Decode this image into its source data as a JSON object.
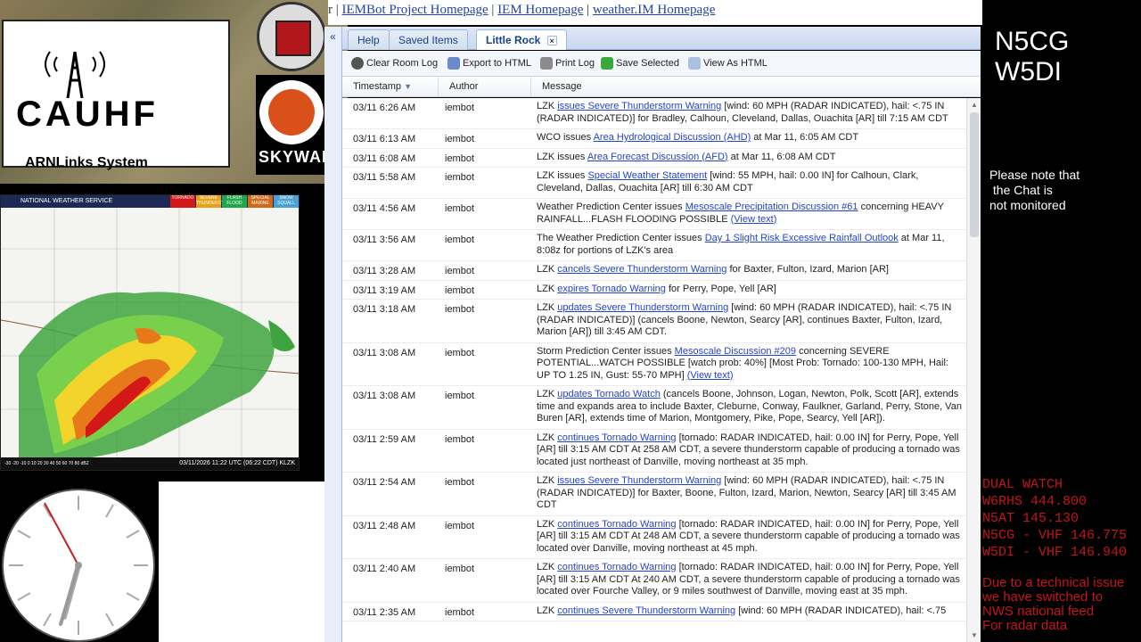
{
  "branding": {
    "logo_text": "CAUHF",
    "logo_subtitle": "ARNLinks System",
    "skywarn_text": "SKYWARN"
  },
  "radar": {
    "header": "NATIONAL WEATHER SERVICE",
    "legend": [
      "TORNADO",
      "SEVERE THUNDERSTORM",
      "FLASH FLOOD",
      "SPECIAL MARINE",
      "SNOW SQUALL"
    ],
    "timestamp": "03/11/2026 11:22 UTC (06:22 CDT)",
    "station": "KLZK",
    "scale": "-30 -20 -10 0 10 20 30 40 50 60 70 80 dBZ"
  },
  "topbar": {
    "prefix": "r",
    "links": [
      "IEMBot Project Homepage",
      "IEM Homepage",
      "weather.IM Homepage"
    ]
  },
  "tabs": [
    {
      "label": "Help",
      "active": false
    },
    {
      "label": "Saved Items",
      "active": false
    },
    {
      "label": "Little Rock",
      "active": true,
      "close": "×"
    }
  ],
  "collapse_label": "«",
  "toolbar": {
    "clear": "Clear Room Log",
    "export": "Export to HTML",
    "print": "Print Log",
    "save": "Save Selected",
    "view": "View As HTML"
  },
  "columns": {
    "timestamp": "Timestamp",
    "author": "Author",
    "message": "Message"
  },
  "rows": [
    {
      "ts": "03/11 6:26 AM",
      "author": "iembot",
      "pre": "LZK ",
      "link": "issues Severe Thunderstorm Warning",
      "post": " [wind: 60 MPH (RADAR INDICATED), hail: <.75 IN (RADAR INDICATED)] for Bradley, Calhoun, Cleveland, Dallas, Ouachita [AR] till 7:15 AM CDT"
    },
    {
      "ts": "03/11 6:13 AM",
      "author": "iembot",
      "pre": "WCO issues ",
      "link": "Area Hydrological Discussion (AHD)",
      "post": " at Mar 11, 6:05 AM CDT"
    },
    {
      "ts": "03/11 6:08 AM",
      "author": "iembot",
      "pre": "LZK issues ",
      "link": "Area Forecast Discussion (AFD)",
      "post": " at Mar 11, 6:08 AM CDT"
    },
    {
      "ts": "03/11 5:58 AM",
      "author": "iembot",
      "pre": "LZK issues ",
      "link": "Special Weather Statement",
      "post": " [wind: 55 MPH, hail: 0.00 IN] for Calhoun, Clark, Cleveland, Dallas, Ouachita [AR] till 6:30 AM CDT"
    },
    {
      "ts": "03/11 4:56 AM",
      "author": "iembot",
      "pre": "Weather Prediction Center issues ",
      "link": "Mesoscale Precipitation Discussion #61",
      "post": " concerning HEAVY RAINFALL...FLASH FLOODING POSSIBLE ",
      "link2": "(View text)"
    },
    {
      "ts": "03/11 3:56 AM",
      "author": "iembot",
      "pre": "The Weather Prediction Center issues ",
      "link": "Day 1 Slight Risk Excessive Rainfall Outlook",
      "post": " at Mar 11, 8:08z for portions of LZK's area"
    },
    {
      "ts": "03/11 3:28 AM",
      "author": "iembot",
      "pre": "LZK ",
      "link": "cancels Severe Thunderstorm Warning",
      "post": " for Baxter, Fulton, Izard, Marion [AR]"
    },
    {
      "ts": "03/11 3:19 AM",
      "author": "iembot",
      "pre": "LZK ",
      "link": "expires Tornado Warning",
      "post": " for Perry, Pope, Yell [AR]"
    },
    {
      "ts": "03/11 3:18 AM",
      "author": "iembot",
      "pre": "LZK ",
      "link": "updates Severe Thunderstorm Warning",
      "post": " [wind: 60 MPH (RADAR INDICATED), hail: <.75 IN (RADAR INDICATED)] (cancels Boone, Newton, Searcy [AR], continues Baxter, Fulton, Izard, Marion [AR]) till 3:45 AM CDT."
    },
    {
      "ts": "03/11 3:08 AM",
      "author": "iembot",
      "pre": "Storm Prediction Center issues ",
      "link": "Mesoscale Discussion #209",
      "post": " concerning SEVERE POTENTIAL...WATCH POSSIBLE [watch prob: 40%] [Most Prob: Tornado: 100-130 MPH, Hail: UP TO 1.25 IN, Gust: 55-70 MPH] ",
      "link2": "(View text)"
    },
    {
      "ts": "03/11 3:08 AM",
      "author": "iembot",
      "pre": "LZK ",
      "link": "updates Tornado Watch",
      "post": " (cancels Boone, Johnson, Logan, Newton, Polk, Scott [AR], extends time and expands area to include Baxter, Cleburne, Conway, Faulkner, Garland, Perry, Stone, Van Buren [AR], extends time of Marion, Montgomery, Pike, Pope, Searcy, Yell [AR])."
    },
    {
      "ts": "03/11 2:59 AM",
      "author": "iembot",
      "pre": "LZK ",
      "link": "continues Tornado Warning",
      "post": " [tornado: RADAR INDICATED, hail: 0.00 IN] for Perry, Pope, Yell [AR] till 3:15 AM CDT At 258 AM CDT, a severe thunderstorm capable of producing a tornado was located just northeast of Danville, moving northeast at 35 mph."
    },
    {
      "ts": "03/11 2:54 AM",
      "author": "iembot",
      "pre": "LZK ",
      "link": "issues Severe Thunderstorm Warning",
      "post": " [wind: 60 MPH (RADAR INDICATED), hail: <.75 IN (RADAR INDICATED)] for Baxter, Boone, Fulton, Izard, Marion, Newton, Searcy [AR] till 3:45 AM CDT"
    },
    {
      "ts": "03/11 2:48 AM",
      "author": "iembot",
      "pre": "LZK ",
      "link": "continues Tornado Warning",
      "post": " [tornado: RADAR INDICATED, hail: 0.00 IN] for Perry, Pope, Yell [AR] till 3:15 AM CDT At 248 AM CDT, a severe thunderstorm capable of producing a tornado was located over Danville, moving northeast at 45 mph."
    },
    {
      "ts": "03/11 2:40 AM",
      "author": "iembot",
      "pre": "LZK ",
      "link": "continues Tornado Warning",
      "post": " [tornado: RADAR INDICATED, hail: 0.00 IN] for Perry, Pope, Yell [AR] till 3:15 AM CDT At 240 AM CDT, a severe thunderstorm capable of producing a tornado was located over Fourche Valley, or 9 miles southwest of Danville, moving east at 35 mph."
    },
    {
      "ts": "03/11 2:35 AM",
      "author": "iembot",
      "pre": "LZK ",
      "link": "continues Severe Thunderstorm Warning",
      "post": " [wind: 60 MPH (RADAR INDICATED), hail: <.75"
    }
  ],
  "right_panel": {
    "callsign1": "N5CG",
    "callsign2": "W5DI",
    "note": "Please note that\n the Chat is\nnot monitored",
    "dual_watch": "DUAL WATCH\nW6RHS 444.800\nN5AT 145.130\nN5CG - VHF 146.775\nW5DI - VHF 146.940",
    "tech_issue": "Due to a technical issue\nwe have switched to\nNWS national feed\nFor radar data"
  },
  "colors": {
    "link": "#2244cc",
    "ext_tab_bg": "#dfe8f6",
    "alert_red": "#c3151c"
  }
}
